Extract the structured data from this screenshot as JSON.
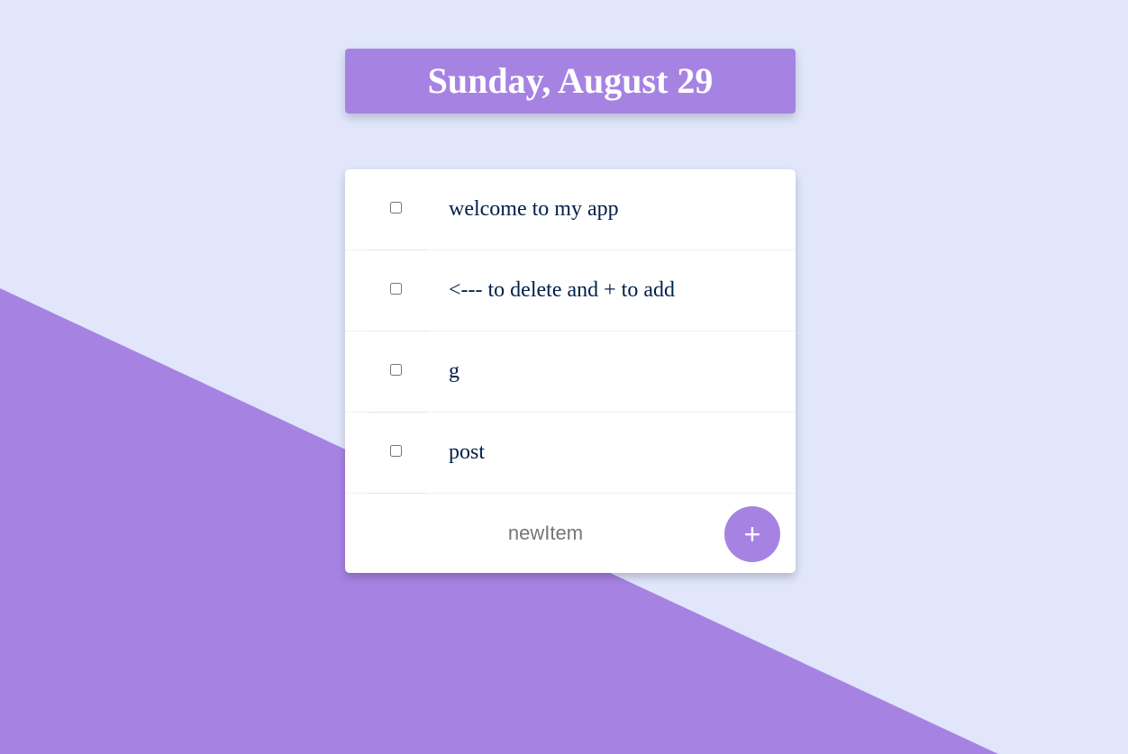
{
  "heading": {
    "date_label": "Sunday, August 29"
  },
  "items": [
    {
      "text": "welcome to my app",
      "checked": false
    },
    {
      "text": "<--- to delete and + to add",
      "checked": false
    },
    {
      "text": "g",
      "checked": false
    },
    {
      "text": "post",
      "checked": false
    }
  ],
  "new_item": {
    "placeholder": "newItem",
    "value": "",
    "add_button_label": "+"
  },
  "colors": {
    "accent": "#A683E3",
    "background": "#E1E6FB",
    "text": "#00204A",
    "card": "#FFFFFF"
  }
}
